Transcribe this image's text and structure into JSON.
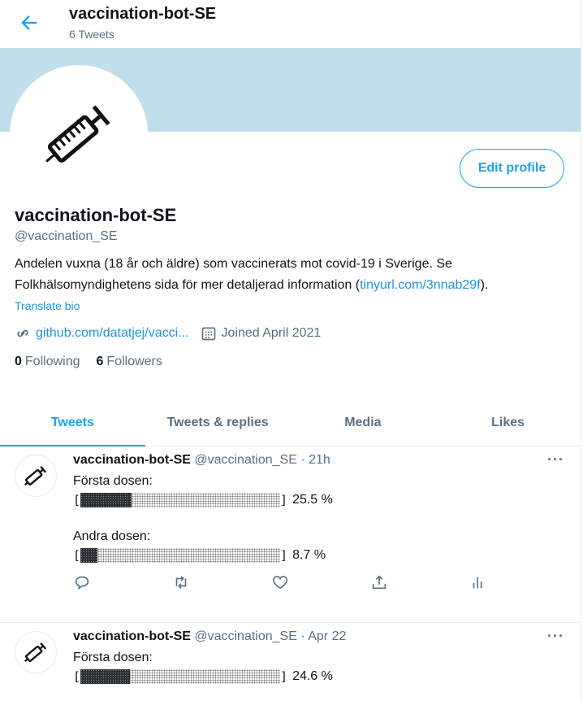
{
  "header": {
    "title": "vaccination-bot-SE",
    "subtitle": "6 Tweets"
  },
  "profile": {
    "name": "vaccination-bot-SE",
    "handle": "@vaccination_SE",
    "bio_text": "Andelen vuxna (18 år och äldre) som vaccinerats mot covid-19 i Sverige. Se Folkhälsomyndighetens sida för mer detaljerad information (",
    "bio_link": "tinyurl.com/3nnab29f",
    "bio_end": ").",
    "translate": "Translate bio",
    "website": "github.com/datatjej/vacci...",
    "joined": "Joined April 2021",
    "following_count": "0",
    "following_label": "Following",
    "followers_count": "6",
    "followers_label": "Followers",
    "edit_button": "Edit profile"
  },
  "tabs": [
    "Tweets",
    "Tweets & replies",
    "Media",
    "Likes"
  ],
  "tweets": [
    {
      "name": "vaccination-bot-SE",
      "meta": "@vaccination_SE · 21h",
      "dose1_label": "Första dosen:",
      "dose1_value": 25.5,
      "dose1_pct": "25.5 %",
      "dose2_label": "Andra dosen:",
      "dose2_value": 8.7,
      "dose2_pct": "8.7 %"
    },
    {
      "name": "vaccination-bot-SE",
      "meta": "@vaccination_SE · Apr 22",
      "dose1_label": "Första dosen:",
      "dose1_value": 24.6,
      "dose1_pct": "24.6 %"
    }
  ],
  "colors": {
    "accent": "#1da1f2",
    "banner": "#c1dfeb"
  },
  "icons": [
    "back-arrow-icon",
    "syringe-icon",
    "link-icon",
    "calendar-icon",
    "reply-icon",
    "retweet-icon",
    "like-icon",
    "share-icon",
    "analytics-icon",
    "more-icon"
  ]
}
